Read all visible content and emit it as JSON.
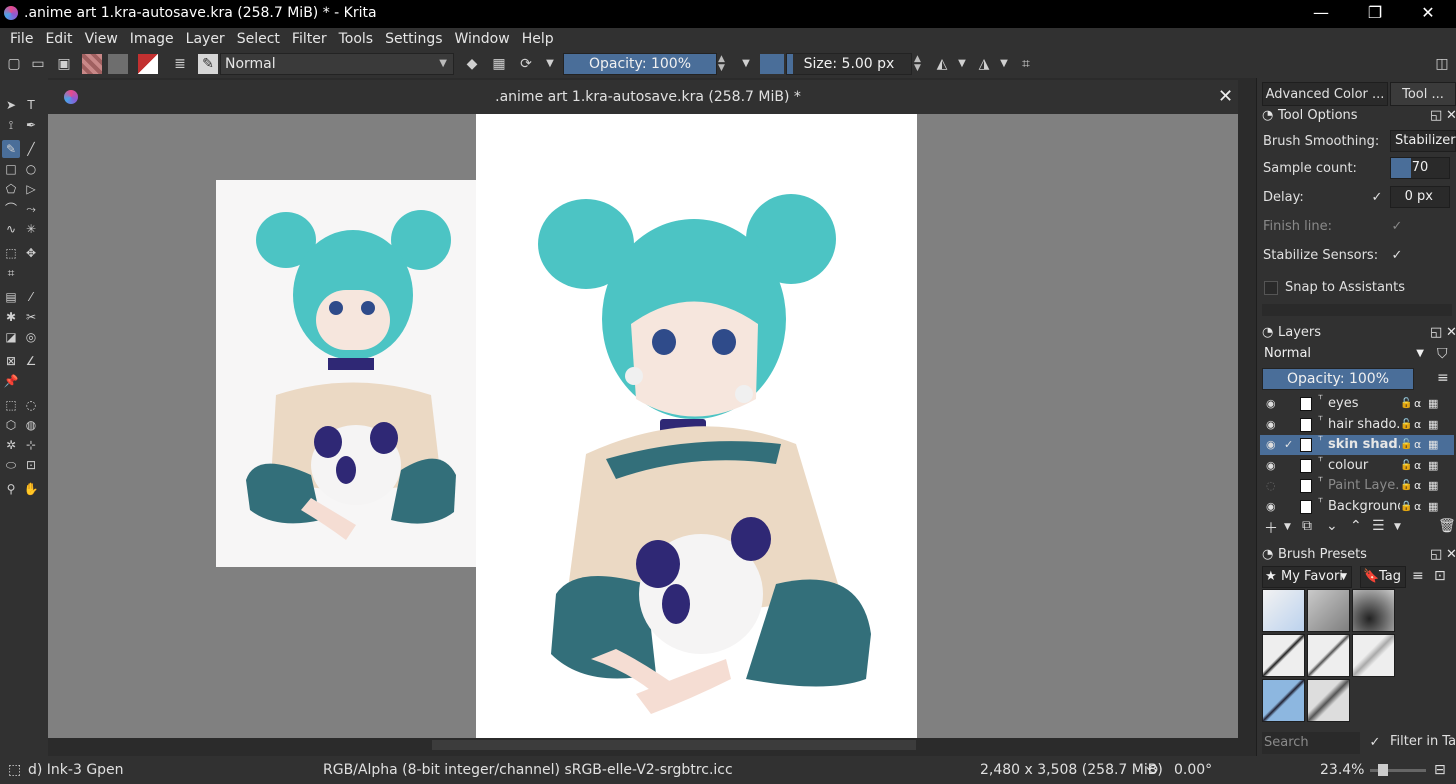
{
  "window": {
    "title": ".anime art 1.kra-autosave.kra (258.7 MiB) * - Krita",
    "minimize": "—",
    "maximize": "❐",
    "close": "✕"
  },
  "menu": [
    "File",
    "Edit",
    "View",
    "Image",
    "Layer",
    "Select",
    "Filter",
    "Tools",
    "Settings",
    "Window",
    "Help"
  ],
  "toolbar": {
    "blend_mode": "Normal",
    "opacity_label": "Opacity: 100%",
    "opacity_fraction": 1.0,
    "size_label": "Size: 5.00 px",
    "size_fraction": 0.05
  },
  "document": {
    "tab_title": ".anime art 1.kra-autosave.kra (258.7 MiB) *",
    "close": "✕"
  },
  "dock": {
    "tabs": [
      "Advanced Color ...",
      "Tool ..."
    ],
    "tool_options": {
      "title": "Tool Options",
      "brush_smoothing_label": "Brush Smoothing:",
      "brush_smoothing_value": "Stabilizer",
      "sample_count_label": "Sample count:",
      "sample_count_value": "70",
      "sample_count_fraction": 0.35,
      "delay_label": "Delay:",
      "delay_value": "0 px",
      "delay_checked": true,
      "finish_line_label": "Finish line:",
      "finish_line_checked": true,
      "stabilize_sensors_label": "Stabilize Sensors:",
      "stabilize_sensors_checked": true,
      "snap_label": "Snap to Assistants",
      "snap_checked": false
    },
    "layers": {
      "title": "Layers",
      "blend_mode": "Normal",
      "opacity_label": "Opacity:  100%",
      "opacity_fraction": 1.0,
      "items": [
        {
          "name": "eyes",
          "visible": true,
          "selected": false,
          "locked": false
        },
        {
          "name": "hair shado...",
          "visible": true,
          "selected": false,
          "locked": false
        },
        {
          "name": "skin shad...",
          "visible": true,
          "selected": true,
          "locked": false
        },
        {
          "name": "colour",
          "visible": true,
          "selected": false,
          "locked": false
        },
        {
          "name": "Paint Laye...",
          "visible": false,
          "selected": false,
          "locked": false
        },
        {
          "name": "Background",
          "visible": true,
          "selected": false,
          "locked": true
        }
      ]
    },
    "brush_presets": {
      "title": "Brush Presets",
      "tag_filter": "My Favori",
      "tag_button": "Tag",
      "search_placeholder": "Search",
      "filter_in_tag_label": "Filter in Tag",
      "filter_in_tag_checked": true
    }
  },
  "status": {
    "brush": "d) Ink-3 Gpen",
    "color_profile": "RGB/Alpha (8-bit integer/channel)  sRGB-elle-V2-srgbtrc.icc",
    "image_size": "2,480 x 3,508 (258.7 MiB)",
    "rotation": "0.00°",
    "zoom": "23.4%"
  },
  "colors": {
    "accent": "#4a6e99",
    "panel": "#313131",
    "canvas_bg": "#808080",
    "hair": "#4cc4c4",
    "sweater": "#ebd9c4",
    "sleeve": "#336f7a",
    "panda_dark": "#2f2875"
  }
}
